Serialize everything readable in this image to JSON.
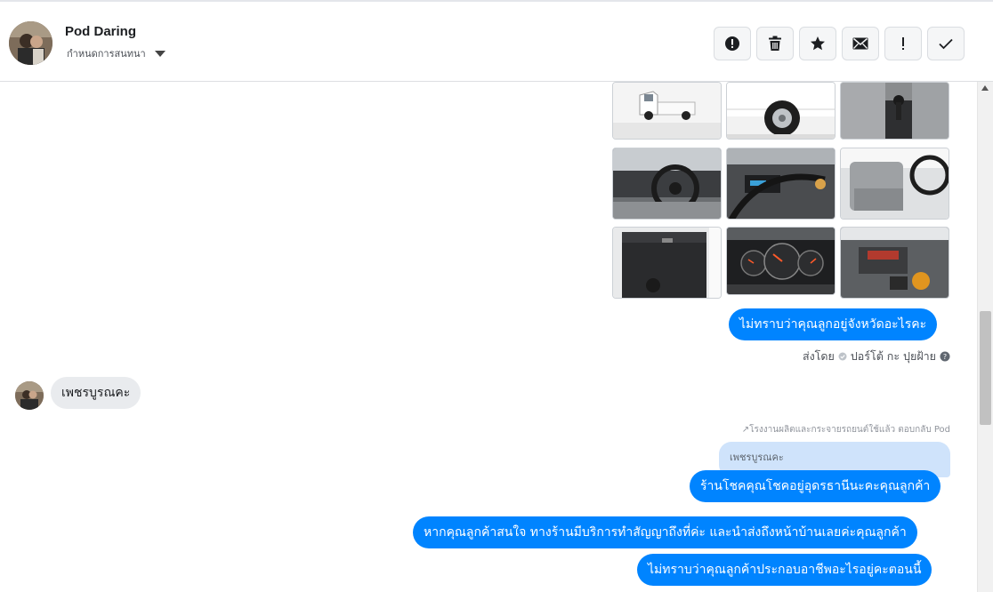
{
  "header": {
    "contact_name": "Pod Daring",
    "assign_label": "กำหนดการสนทนา",
    "toolbar": [
      {
        "name": "spam-button",
        "icon": "alert-circle-icon"
      },
      {
        "name": "delete-button",
        "icon": "trash-icon"
      },
      {
        "name": "star-button",
        "icon": "star-icon"
      },
      {
        "name": "mark-unread-button",
        "icon": "envelope-icon"
      },
      {
        "name": "follow-up-button",
        "icon": "exclamation-icon"
      },
      {
        "name": "mark-done-button",
        "icon": "check-icon"
      }
    ]
  },
  "photos": [
    {
      "name": "photo-truck-side"
    },
    {
      "name": "photo-truck-wheel"
    },
    {
      "name": "photo-seat-fabric-shifter"
    },
    {
      "name": "photo-dashboard-steering"
    },
    {
      "name": "photo-center-console"
    },
    {
      "name": "photo-interior-seats"
    },
    {
      "name": "photo-door-panel"
    },
    {
      "name": "photo-instrument-cluster"
    },
    {
      "name": "photo-engine-bay"
    }
  ],
  "messages": {
    "out_1": "ไม่ทราบว่าคุณลูกอยู่จังหวัดอะไรคะ",
    "sent_by_prefix": "ส่งโดย",
    "sent_by_name": "ปอร์โต้ กะ ปุยฝ้าย",
    "in_1": "เพชรบูรณคะ",
    "reply_note": "โรงงานผลิตและกระจายรถยนต์ใช้แล้ว ตอบกลับ Pod",
    "quoted_text": "เพชรบูรณคะ",
    "out_2": "ร้านโชคคุณโชคอยู่อุดรธานีนะคะคุณลูกค้า",
    "out_3": "หากคุณลูกค้าสนใจ ทางร้านมีบริการทำสัญญาถึงที่ค่ะ และนำส่งถึงหน้าบ้านเลยค่ะคุณลูกค้า",
    "out_4": "ไม่ทราบว่าคุณลูกค้าประกอบอาชีพอะไรอยู่คะตอนนี้"
  },
  "colors": {
    "outgoing_bubble": "#0084ff",
    "incoming_bubble": "#e9ebee",
    "quote_bubble": "#cfe3fb"
  }
}
